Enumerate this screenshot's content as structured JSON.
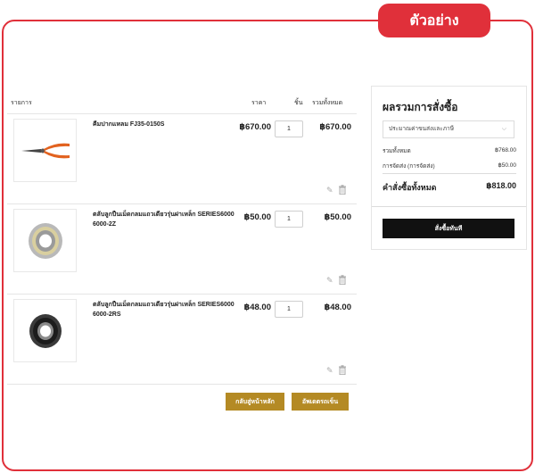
{
  "badge": "ตัวอย่าง",
  "cart": {
    "headers": {
      "item": "รายการ",
      "price": "ราคา",
      "qty": "ชิ้น",
      "total": "รวมทั้งหมด"
    },
    "items": [
      {
        "name": "คีมปากแหลม FJ35-0150S",
        "price": "฿670.00",
        "qty": "1",
        "total": "฿670.00",
        "image": "needle-nose-pliers-image"
      },
      {
        "name": "ตลับลูกปืนเม็ดกลมแถวเดียวรุ่นฝาเหล็ก SERIES6000 6000-2Z",
        "price": "฿50.00",
        "qty": "1",
        "total": "฿50.00",
        "image": "metal-shield-bearing-image"
      },
      {
        "name": "ตลับลูกปืนเม็ดกลมแถวเดียวรุ่นฝาเหล็ก SERIES6000 6000-2RS",
        "price": "฿48.00",
        "qty": "1",
        "total": "฿48.00",
        "image": "rubber-seal-bearing-image"
      }
    ],
    "back_button": "กลับสู่หน้าหลัก",
    "update_button": "อัพเดตรถเข็น"
  },
  "summary": {
    "title": "ผลรวมการสั่งซื้อ",
    "shipping_select": "ประมาณค่าขนส่งและภาษี",
    "subtotal_label": "รวมทั้งหมด",
    "subtotal_value": "฿768.00",
    "shipping_label": "การจัดส่ง (การจัดส่ง)",
    "shipping_value": "฿50.00",
    "grand_label": "คำสั่งซื้อทั้งหมด",
    "grand_value": "฿818.00",
    "order_button": "สั่งซื้อทันที"
  },
  "colors": {
    "accent_red": "#e0303a",
    "button_gold": "#b48a24",
    "order_button": "#111111"
  }
}
